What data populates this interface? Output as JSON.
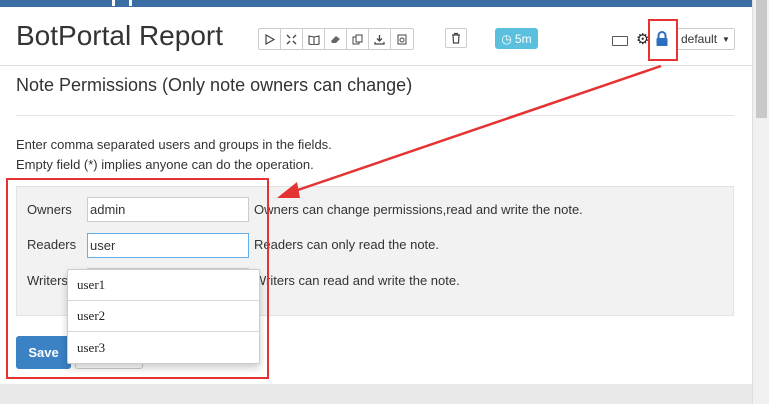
{
  "header": {
    "title": "BotPortal Report",
    "toolbar_icons": [
      "run-icon",
      "hide-code-icon",
      "book-icon",
      "eraser-icon",
      "clone-icon",
      "export-icon",
      "version-icon"
    ],
    "trash_icon": "trash-icon",
    "timer_label": "5m",
    "keyboard_icon": "keyboard-icon",
    "settings_icon": "gear-icon",
    "lock_icon": "lock-icon",
    "interpreter_select": "default"
  },
  "permissions": {
    "title": "Note Permissions (Only note owners can change)",
    "instruction_1": "Enter comma separated users and groups in the fields.",
    "instruction_2": "Empty field (*) implies anyone can do the operation.",
    "owners": {
      "label": "Owners",
      "value": "admin",
      "help": "Owners can change permissions,read and write the note."
    },
    "readers": {
      "label": "Readers",
      "value": "user",
      "help": "Readers can only read the note."
    },
    "writers": {
      "label": "Writers",
      "value": "",
      "help": "Writers can read and write the note."
    },
    "save_label": "Save",
    "cancel_label": ""
  },
  "autocomplete": {
    "options": [
      "user1",
      "user2",
      "user3"
    ]
  },
  "colors": {
    "accent": "#3a82c4",
    "timer": "#5bc0de",
    "annotation": "#e53333",
    "lock": "#2a6fc0"
  }
}
